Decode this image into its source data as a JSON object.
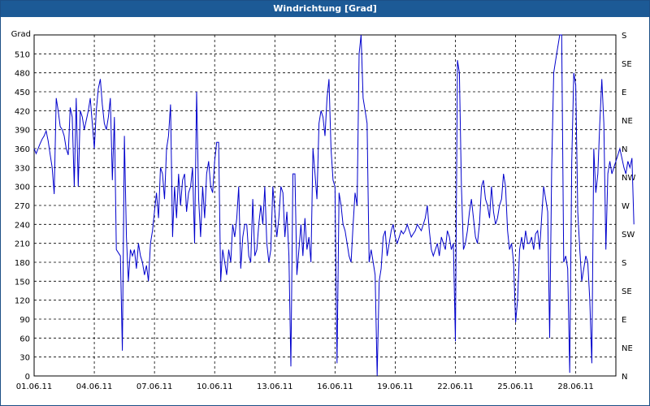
{
  "window": {
    "title": "Windrichtung [Grad]"
  },
  "colors": {
    "titlebar": "#1c5a96",
    "series": "#0000cc",
    "grid": "#000000"
  },
  "chart_data": {
    "type": "line",
    "title": "Windrichtung [Grad]",
    "ylabel": "Grad",
    "xlabel": "",
    "ylim": [
      0,
      540
    ],
    "xlim": [
      "01.06.11",
      "30.06.11"
    ],
    "grid": true,
    "y_ticks": [
      0,
      30,
      60,
      90,
      120,
      150,
      180,
      210,
      240,
      270,
      300,
      330,
      360,
      390,
      420,
      450,
      480,
      510
    ],
    "x_ticks": [
      "01.06.11",
      "04.06.11",
      "07.06.11",
      "10.06.11",
      "13.06.11",
      "16.06.11",
      "19.06.11",
      "22.06.11",
      "25.06.11",
      "28.06.11"
    ],
    "right_axis_labels": [
      "N",
      "NE",
      "E",
      "SE",
      "S",
      "SW",
      "W",
      "NW",
      "N",
      "NE",
      "E",
      "SE",
      "S"
    ],
    "series": [
      {
        "x_days": [
          0,
          0.1,
          0.2,
          0.3,
          0.4,
          0.5,
          0.6,
          0.7,
          0.8,
          0.9,
          1.0,
          1.1,
          1.2,
          1.3,
          1.4,
          1.5,
          1.6,
          1.7,
          1.8,
          1.9,
          2.0,
          2.1,
          2.2,
          2.3,
          2.4,
          2.5,
          2.6,
          2.7,
          2.8,
          2.9,
          3.0,
          3.1,
          3.2,
          3.3,
          3.4,
          3.5,
          3.6,
          3.7,
          3.8,
          3.9,
          4.0,
          4.1,
          4.2,
          4.3,
          4.4,
          4.5,
          4.6,
          4.7,
          4.8,
          4.9,
          5.0,
          5.1,
          5.2,
          5.3,
          5.4,
          5.5,
          5.6,
          5.7,
          5.8,
          5.9,
          6.0,
          6.1,
          6.2,
          6.3,
          6.4,
          6.5,
          6.6,
          6.7,
          6.8,
          6.9,
          7.0,
          7.1,
          7.2,
          7.3,
          7.4,
          7.5,
          7.6,
          7.7,
          7.8,
          7.9,
          8.0,
          8.1,
          8.2,
          8.3,
          8.4,
          8.5,
          8.6,
          8.7,
          8.8,
          8.9,
          9.0,
          9.1,
          9.2,
          9.3,
          9.4,
          9.5,
          9.6,
          9.7,
          9.8,
          9.9,
          10.0,
          10.1,
          10.2,
          10.3,
          10.4,
          10.5,
          10.6,
          10.7,
          10.8,
          10.9,
          11.0,
          11.1,
          11.2,
          11.3,
          11.4,
          11.5,
          11.6,
          11.7,
          11.8,
          11.9,
          12.0,
          12.1,
          12.2,
          12.3,
          12.4,
          12.5,
          12.6,
          12.7,
          12.8,
          12.9,
          13.0,
          13.1,
          13.2,
          13.3,
          13.4,
          13.5,
          13.6,
          13.7,
          13.8,
          13.9,
          14.0,
          14.1,
          14.2,
          14.3,
          14.4,
          14.5,
          14.6,
          14.7,
          14.8,
          14.9,
          15.0,
          15.1,
          15.2,
          15.3,
          15.4,
          15.5,
          15.6,
          15.7,
          15.8,
          15.9,
          16.0,
          16.1,
          16.2,
          16.3,
          16.4,
          16.5,
          16.6,
          16.7,
          16.8,
          16.9,
          17.0,
          17.1,
          17.2,
          17.3,
          17.4,
          17.5,
          17.6,
          17.7,
          17.8,
          17.9,
          18.0,
          18.1,
          18.2,
          18.3,
          18.4,
          18.5,
          18.6,
          18.7,
          18.8,
          18.9,
          19.0,
          19.1,
          19.2,
          19.3,
          19.4,
          19.5,
          19.6,
          19.7,
          19.8,
          19.9,
          20.0,
          20.1,
          20.2,
          20.3,
          20.4,
          20.5,
          20.6,
          20.7,
          20.8,
          20.9,
          21.0,
          21.1,
          21.2,
          21.3,
          21.4,
          21.5,
          21.6,
          21.7,
          21.8,
          21.9,
          22.0,
          22.1,
          22.2,
          22.3,
          22.4,
          22.5,
          22.6,
          22.7,
          22.8,
          22.9,
          23.0,
          23.1,
          23.2,
          23.3,
          23.4,
          23.5,
          23.6,
          23.7,
          23.8,
          23.9,
          24.0,
          24.1,
          24.2,
          24.3,
          24.4,
          24.5,
          24.6,
          24.7,
          24.8,
          24.9,
          25.0,
          25.1,
          25.2,
          25.3,
          25.4,
          25.5,
          25.6,
          25.7,
          25.8,
          25.9,
          26.0,
          26.1,
          26.2,
          26.3,
          26.4,
          26.5,
          26.6,
          26.7,
          26.8,
          26.9,
          27.0,
          27.1,
          27.2,
          27.3,
          27.4,
          27.5,
          27.6,
          27.7,
          27.8,
          27.9,
          28.0,
          28.1,
          28.2,
          28.3,
          28.4,
          28.5,
          28.6,
          28.7,
          28.8,
          28.9,
          29.0,
          29.1,
          29.2,
          29.3,
          29.4,
          29.5,
          29.6,
          29.7,
          29.8,
          29.9,
          30.0
        ],
        "values": [
          360,
          352,
          360,
          368,
          375,
          380,
          388,
          372,
          350,
          330,
          288,
          440,
          420,
          395,
          390,
          380,
          360,
          350,
          425,
          410,
          300,
          440,
          300,
          420,
          410,
          390,
          405,
          420,
          440,
          400,
          360,
          420,
          455,
          470,
          430,
          400,
          390,
          410,
          440,
          310,
          410,
          200,
          195,
          190,
          40,
          380,
          220,
          150,
          200,
          190,
          200,
          170,
          210,
          190,
          180,
          160,
          175,
          150,
          210,
          230,
          260,
          290,
          250,
          330,
          320,
          280,
          360,
          380,
          430,
          220,
          300,
          250,
          320,
          270,
          310,
          320,
          260,
          290,
          300,
          330,
          210,
          450,
          280,
          220,
          300,
          250,
          320,
          340,
          300,
          290,
          340,
          370,
          370,
          150,
          200,
          180,
          160,
          200,
          180,
          240,
          220,
          250,
          300,
          170,
          220,
          240,
          240,
          190,
          180,
          280,
          190,
          200,
          240,
          270,
          240,
          300,
          210,
          180,
          200,
          300,
          260,
          220,
          250,
          300,
          290,
          220,
          260,
          190,
          15,
          320,
          320,
          160,
          200,
          240,
          190,
          250,
          200,
          220,
          180,
          360,
          320,
          280,
          400,
          420,
          410,
          380,
          440,
          470,
          360,
          310,
          300,
          20,
          290,
          270,
          240,
          230,
          210,
          190,
          180,
          240,
          290,
          270,
          510,
          560,
          440,
          420,
          400,
          180,
          200,
          180,
          160,
          0,
          150,
          170,
          220,
          230,
          190,
          210,
          230,
          240,
          220,
          210,
          220,
          230,
          225,
          230,
          240,
          230,
          220,
          225,
          230,
          240,
          235,
          230,
          240,
          250,
          270,
          230,
          200,
          190,
          200,
          210,
          190,
          220,
          210,
          200,
          230,
          220,
          200,
          210,
          55,
          500,
          480,
          300,
          200,
          210,
          230,
          260,
          280,
          250,
          220,
          210,
          240,
          300,
          310,
          280,
          270,
          250,
          300,
          260,
          240,
          250,
          270,
          280,
          320,
          300,
          230,
          200,
          210,
          180,
          85,
          120,
          200,
          220,
          200,
          230,
          210,
          210,
          220,
          200,
          225,
          230,
          200,
          250,
          300,
          280,
          260,
          60,
          330,
          480,
          500,
          520,
          560,
          540,
          180,
          190,
          170,
          5,
          340,
          480,
          460,
          260,
          200,
          150,
          170,
          190,
          180,
          120,
          20,
          360,
          290,
          320,
          400,
          470,
          400,
          200,
          320,
          340,
          320,
          330,
          340,
          350,
          360,
          345,
          330,
          320,
          340,
          330,
          345,
          240
        ]
      }
    ]
  }
}
